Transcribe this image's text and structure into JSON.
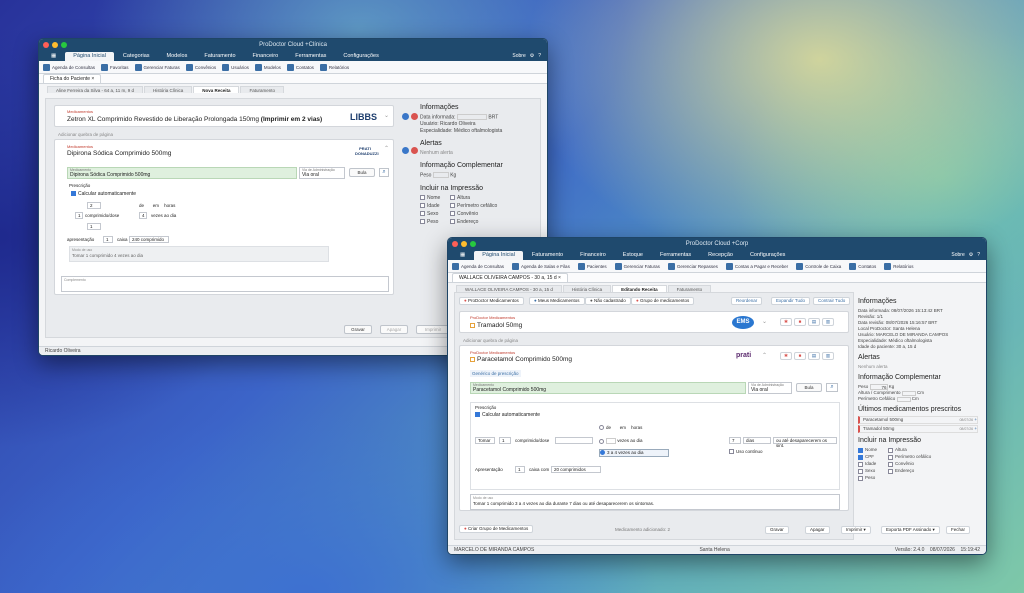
{
  "desktop": {
    "bg": "#2a3c9a"
  },
  "w1": {
    "title": "ProDoctor Cloud +Clínica",
    "menu": [
      "Página Inicial",
      "Categorias",
      "Modelos",
      "Faturamento",
      "Financeiro",
      "Ferramentas",
      "Configurações"
    ],
    "menu_right": "Sobre",
    "toolbar": [
      "Agenda de Consultas",
      "Favoritas",
      "Gerenciar Faturas",
      "Convênios",
      "Usuários",
      "Modelos",
      "Contatos",
      "Relatórios"
    ],
    "page_tab": "Ficha do Paciente",
    "inner_tabs": [
      "Aline Ferreira da Silva - 64 a, 11 m, 9 d",
      "História Clínica",
      "Nova Receita",
      "Faturamento"
    ],
    "med1": {
      "label": "Medicamentos",
      "name": "Zetron XL Comprimido Revestido de Liberação Prolongada 150mg",
      "suffix": "(Imprimir em 2 vias)",
      "brand": "LIBBS"
    },
    "add_above": "Adicionar quebra de página",
    "med2": {
      "label": "Medicamentos",
      "name": "Dipirona Sódica Comprimido 500mg",
      "brand": "PRATI DONADUZZI"
    },
    "med_field_label": "Medicamento",
    "med_field": "Dipirona Sódica Comprimido 500mg",
    "via_label": "Via de Administração",
    "via": "Via oral",
    "bula": "Bula",
    "prescricao": "Prescrição",
    "calc": "Calcular automaticamente",
    "q1": "2",
    "q2": "1",
    "unit1": "comprimido/dose",
    "q3": "4",
    "q4": "1",
    "de": "de",
    "em": "em",
    "horas": "horas",
    "vezes": "vezes ao dia",
    "apresentacao": "apresentação",
    "apq": "1",
    "caixa": "caixa",
    "cpq": "240 comprimido",
    "modo_label": "Modo de uso",
    "modo": "Tomar 1 comprimido 4 vezes ao dia",
    "complemento": "Complemento",
    "side": {
      "info": "Informações",
      "data_label": "Data informada:",
      "data_suffix": "BRT",
      "usuario": "Usuário: Ricardo Oliveira",
      "esp": "Especialidade: Médico oftalmologista",
      "alertas": "Alertas",
      "nenhum": "Nenhum alerta",
      "infcomp": "Informação Complementar",
      "peso": "Peso",
      "kg": "Kg",
      "incluir": "Incluir na Impressão",
      "checks": [
        "Nome",
        "Altura",
        "Idade",
        "Perímetro cefálico",
        "Sexo",
        "Convênio",
        "Peso",
        "Endereço"
      ]
    },
    "buttons": [
      "Gravar",
      "Apagar",
      "Imprimir"
    ],
    "status": "Ricardo Oliveira"
  },
  "w2": {
    "title": "ProDoctor Cloud +Corp",
    "menu": [
      "Página Inicial",
      "Faturamento",
      "Financeiro",
      "Estoque",
      "Ferramentas",
      "Recepção",
      "Configurações"
    ],
    "menu_right": "Sobre",
    "toolbar": [
      "Agenda de Consultas",
      "Agenda de Salas e Filas",
      "Pacientes",
      "Gerenciar Faturas",
      "Gerenciar Repasses",
      "Contas a Pagar e Receber",
      "Controle de Caixa",
      "Contatos",
      "Relatórios"
    ],
    "page_tab": "WALLACE OLIVEIRA CAMPOS - 30 a, 15 d",
    "inner_tabs": [
      "WALLACE OLIVEIRA CAMPOS - 30 a, 15 d",
      "História Clínica",
      "Editando Receita",
      "Faturamento"
    ],
    "actions": [
      "ProDoctor Medicamentos",
      "Meus Medicamentos",
      "Não cadastrado",
      "Grupo de medicamentos"
    ],
    "actions_right": [
      "Reordenar",
      "Expandir Tudo",
      "Contrair Tudo"
    ],
    "med1": {
      "label": "ProDoctor Medicamentos",
      "name": "Tramadol 50mg",
      "brand": "EMS"
    },
    "add_above": "Adicionar quebra de página",
    "med2": {
      "label": "ProDoctor Medicamentos",
      "name": "Paracetamol Comprimido 500mg",
      "brand": "prati"
    },
    "gen": "Genérico de prescrição",
    "med_field_label": "Medicamento",
    "med_field": "Paracetamol Comprimido 500mg",
    "via_label": "Via de Administração",
    "via": "Via oral",
    "bula": "Bula",
    "prescricao": "Prescrição",
    "calc": "Calcular automaticamente",
    "tomar": "Tomar",
    "q1": "1",
    "unit1": "comprimido/dose",
    "de": "de",
    "em": "em",
    "horas": "horas",
    "vezes": "vezes ao dia",
    "opt": "3 a 4 vezes ao dia",
    "dias_q": "7",
    "dias": "dias",
    "ate": "ou até desaparecerem os sint.",
    "uso": "Uso contínuo",
    "apresentacao": "Apresentação",
    "apq": "1",
    "caixa": "caixa com",
    "cpq": "20 comprimidos",
    "modo_label": "Modo de uso",
    "modo": "Tomar 1 comprimido 3 a 4 vezes ao dia durante 7 dias ou até desaparecerem os sintomas.",
    "criar": "Criar Grupo de Medicamentos",
    "count": "Medicamento adicionado: 2",
    "buttons": [
      "Gravar",
      "Apagar",
      "Imprimir",
      "Exporta PDF Assinado",
      "Fechar"
    ],
    "side": {
      "info": "Informações",
      "lines": [
        "Data informada: 08/07/2026 15:13:42 BRT",
        "Revisão: 1/1",
        "Data revisão: 08/07/2026 15:16:57 BRT",
        "Local ProDoctor: Santa Helena",
        "Usuário: MARCELO DE MIRANDA CAMPOS",
        "Especialidade: Médico oftalmologista",
        "Idade do paciente: 30 a, 15 d"
      ],
      "alertas": "Alertas",
      "nenhum": "Nenhum alerta",
      "infcomp": "Informação Complementar",
      "peso": "Peso",
      "peso_v": "76",
      "kg": "Kg",
      "altura": "Altura / Comprimento",
      "cm": "Cm",
      "perimetro": "Perímetro Cefálico",
      "ultimos": "Últimos medicamentos prescritos",
      "ult": [
        {
          "n": "Paracetamol 500mg",
          "d": "08/07/26"
        },
        {
          "n": "Tramadol 50mg",
          "d": "08/07/26"
        }
      ],
      "incluir": "Incluir na Impressão",
      "checks": [
        "Nome",
        "Altura",
        "CPF",
        "Perímetro cefálico",
        "Idade",
        "Convênio",
        "Sexo",
        "Endereço",
        "Peso"
      ],
      "checked": [
        true,
        false,
        true,
        false,
        false,
        false,
        false,
        false,
        false
      ]
    },
    "status": {
      "user": "MARCELO DE MIRANDA CAMPOS",
      "local": "Santa Helena",
      "ver": "Versão: 2.4.0",
      "date": "08/07/2026",
      "time": "15:19:42"
    }
  }
}
